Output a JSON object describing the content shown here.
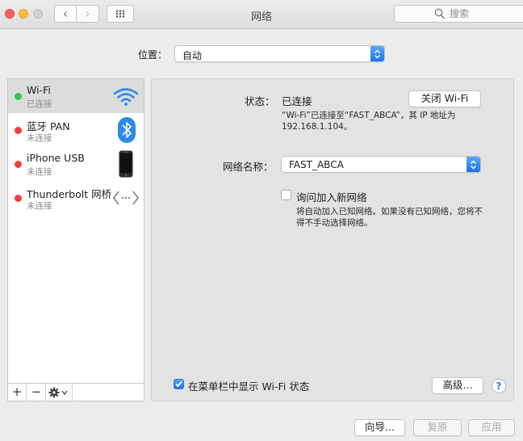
{
  "window": {
    "title": "网络"
  },
  "search": {
    "placeholder": "搜索"
  },
  "location": {
    "label": "位置：",
    "value": "自动"
  },
  "services": [
    {
      "name": "Wi-Fi",
      "status": "已连接",
      "status_color": "#34c84a",
      "icon": "wifi-icon"
    },
    {
      "name": "蓝牙 PAN",
      "status": "未连接",
      "status_color": "#fc3b3b",
      "icon": "bluetooth-icon"
    },
    {
      "name": "iPhone USB",
      "status": "未连接",
      "status_color": "#fc3b3b",
      "icon": "iphone-icon"
    },
    {
      "name": "Thunderbolt 网桥",
      "status": "未连接",
      "status_color": "#fc3b3b",
      "icon": "thunderbolt-bridge-icon"
    }
  ],
  "sidebar_toolbar": {
    "add": "+",
    "remove": "−"
  },
  "detail": {
    "status_label": "状态：",
    "status_value": "已连接",
    "toggle_button": "关闭 Wi-Fi",
    "status_desc_1": "“Wi-Fi”已连接至“FAST_ABCA”，其 IP 地址为",
    "status_desc_2": "192.168.1.104。",
    "network_name_label": "网络名称：",
    "network_name_value": "FAST_ABCA",
    "ask_join_label": "询问加入新网络",
    "ask_join_desc_1": "将自动加入已知网络。如果没有已知网络，您将不",
    "ask_join_desc_2": "得不手动选择网络。",
    "show_menubar_label": "在菜单栏中显示 Wi-Fi 状态",
    "advanced_button": "高级...",
    "help": "?"
  },
  "footer": {
    "assistant": "向导...",
    "revert": "复原",
    "apply": "应用"
  },
  "colors": {
    "accent": "#1a75e6",
    "connected": "#34c84a",
    "disconnected": "#fc3b3b"
  }
}
